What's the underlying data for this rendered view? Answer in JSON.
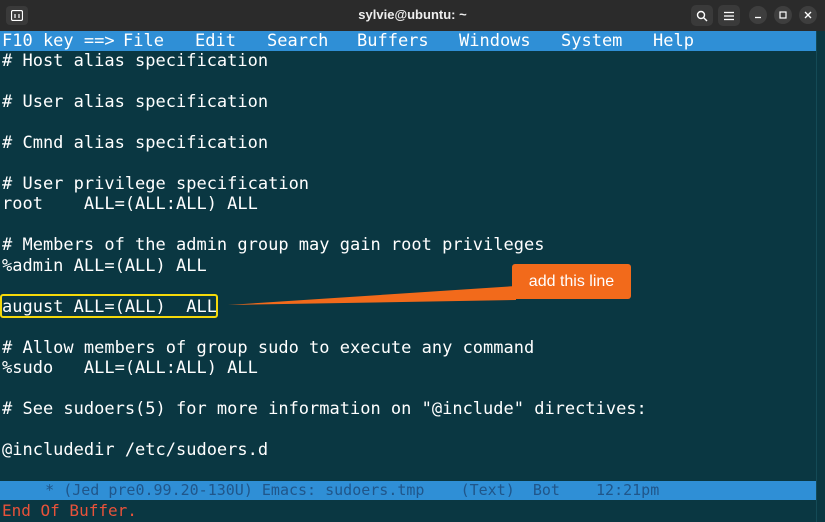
{
  "window": {
    "title": "sylvie@ubuntu: ~",
    "buttons": [
      "search-icon",
      "hamburger-menu-icon",
      "minimize-icon",
      "maximize-icon",
      "close-icon"
    ]
  },
  "menubar": {
    "prefix": "F10 key ==>",
    "items": [
      "File",
      "Edit",
      "Search",
      "Buffers",
      "Windows",
      "System",
      "Help"
    ]
  },
  "editor": {
    "lines": [
      "# Host alias specification",
      "",
      "# User alias specification",
      "",
      "# Cmnd alias specification",
      "",
      "# User privilege specification",
      "root    ALL=(ALL:ALL) ALL",
      "",
      "# Members of the admin group may gain root privileges",
      "%admin ALL=(ALL) ALL",
      "",
      "august ALL=(ALL)  ALL",
      "",
      "# Allow members of group sudo to execute any command",
      "%sudo   ALL=(ALL:ALL) ALL",
      "",
      "# See sudoers(5) for more information on \"@include\" directives:",
      "",
      "@includedir /etc/sudoers.d"
    ]
  },
  "annotation": {
    "callout_text": "add this line",
    "highlight_color": "#f5d90a",
    "callout_color": "#f26a1b"
  },
  "modeline": {
    "text": "     * (Jed pre0.99.20-130U) Emacs: sudoers.tmp    (Text)  Bot    12:21pm"
  },
  "minibuffer": {
    "text": "End Of Buffer."
  },
  "colors": {
    "editor_bg": "#0a3742",
    "menubar_bg": "#2f8fd6",
    "titlebar_bg": "#2b2b2b",
    "minibuffer_text": "#e8523a"
  }
}
